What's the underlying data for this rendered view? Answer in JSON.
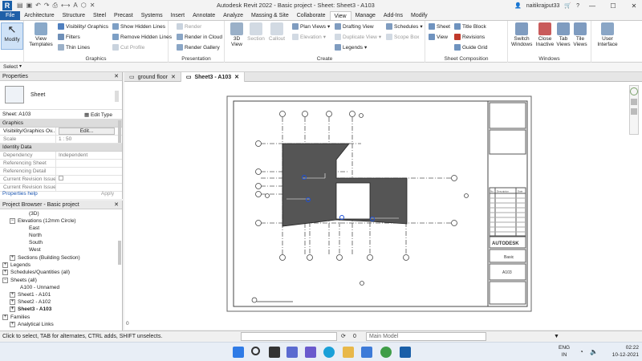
{
  "window": {
    "title": "Autodesk Revit 2022 - Basic project - Sheet: Sheet3 - A103",
    "user": "naitikrajput33"
  },
  "menu_tabs": [
    "File",
    "Architecture",
    "Structure",
    "Steel",
    "Precast",
    "Systems",
    "Insert",
    "Annotate",
    "Analyze",
    "Massing & Site",
    "Collaborate",
    "View",
    "Manage",
    "Add-Ins",
    "Modify"
  ],
  "ribbon": {
    "modify": "Modify",
    "select": "Select",
    "graphics": {
      "label": "Graphics",
      "view_templates": "View Templates",
      "visibility": "Visibility/ Graphics",
      "filters": "Filters",
      "thin_lines": "Thin Lines",
      "show_hidden": "Show Hidden Lines",
      "remove_hidden": "Remove Hidden Lines",
      "cut_profile": "Cut Profile"
    },
    "presentation": {
      "label": "Presentation",
      "render": "Render",
      "render_cloud": "Render in Cloud",
      "render_gallery": "Render Gallery"
    },
    "create": {
      "label": "Create",
      "view_3d": "3D View",
      "section": "Section",
      "callout": "Callout",
      "plan_views": "Plan Views",
      "elevation": "Elevation",
      "drafting_view": "Drafting View",
      "duplicate_view": "Duplicate View",
      "legends": "Legends",
      "schedules": "Schedules",
      "scope_box": "Scope Box"
    },
    "sheet_composition": {
      "label": "Sheet Composition",
      "sheet": "Sheet",
      "title_block": "Title Block",
      "view": "View",
      "revisions": "Revisions",
      "guide_grid": "Guide Grid"
    },
    "windows": {
      "label": "Windows",
      "switch_windows": "Switch Windows",
      "close_inactive": "Close Inactive",
      "tab_views": "Tab Views",
      "tile_views": "Tile Views",
      "user_interface": "User Interface"
    }
  },
  "properties": {
    "title": "Properties",
    "type_name": "Sheet",
    "selector": "Sheet: A103",
    "edit_type": "Edit Type",
    "cat_graphics": "Graphics",
    "vis_label": "Visibility/Graphics Ov...",
    "edit_button": "Edit...",
    "scale_label": "Scale",
    "scale_value": "1 : 50",
    "cat_identity": "Identity Data",
    "dependency_label": "Dependency",
    "dependency_value": "Independent",
    "ref_sheet": "Referencing Sheet",
    "ref_detail": "Referencing Detail",
    "cur_rev_issued": "Current Revision Issued",
    "cur_rev_issue": "Current Revision Issue...",
    "help": "Properties help",
    "apply": "Apply"
  },
  "project_browser": {
    "title": "Project Browser - Basic project",
    "items": [
      "(3D)",
      "Elevations (12mm Circle)",
      "East",
      "North",
      "South",
      "West",
      "Sections (Building Section)",
      "Legends",
      "Schedules/Quantities (all)",
      "Sheets (all)",
      "A100 - Unnamed",
      "Sheet1 - A101",
      "Sheet2 - A102",
      "Sheet3 - A103",
      "Families",
      "Analytical Links"
    ]
  },
  "view_tabs": [
    "ground floor",
    "Sheet3 - A103"
  ],
  "sheet": {
    "brand": "AUTODESK",
    "project": "Basic",
    "sheet_number": "A103",
    "rev_header": [
      "No.",
      "Description",
      "Date"
    ]
  },
  "status": {
    "message": "Click to select, TAB for alternates, CTRL adds, SHIFT unselects.",
    "scale_value": "0",
    "model": "Main Model"
  },
  "taskbar": {
    "lang1": "ENG",
    "lang2": "IN",
    "time": "02:22",
    "date": "10-12-2021"
  },
  "colors": {
    "accent": "#1f5fa8",
    "floor": "#555555",
    "selection": "#1b4fd8"
  }
}
